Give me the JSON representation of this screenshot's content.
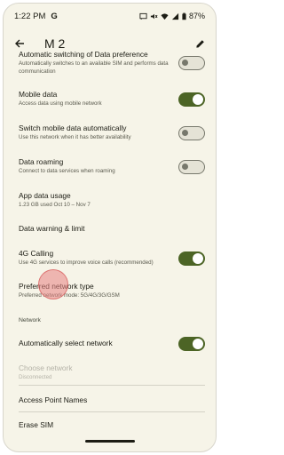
{
  "status_bar": {
    "time": "1:22 PM",
    "google_glyph": "G",
    "battery": "87%",
    "icons": [
      "message-icon",
      "mute-icon",
      "wifi-icon",
      "signal-icon",
      "battery-icon"
    ]
  },
  "header": {
    "title": "M 2",
    "back_icon": "back-arrow-icon",
    "edit_icon": "pencil-icon"
  },
  "rows": [
    {
      "title": "Automatic switching of Data preference",
      "subtitle": "Automatically switches to an available SIM and performs data communication",
      "toggle": "off"
    },
    {
      "title": "Mobile data",
      "subtitle": "Access data using mobile network",
      "toggle": "on"
    },
    {
      "title": "Switch mobile data automatically",
      "subtitle": "Use this network when it has better availability",
      "toggle": "off"
    },
    {
      "title": "Data roaming",
      "subtitle": "Connect to data services when roaming",
      "toggle": "off"
    },
    {
      "title": "App data usage",
      "subtitle": "1.23 GB used Oct 10 – Nov 7"
    },
    {
      "title": "Data warning & limit",
      "subtitle": ""
    },
    {
      "title": "4G Calling",
      "subtitle": "Use 4G services to improve voice calls (recommended)",
      "toggle": "on"
    },
    {
      "title": "Preferred network type",
      "subtitle": "Preferred network mode: 5G/4G/3G/GSM"
    }
  ],
  "network_section": {
    "header": "Network",
    "auto_select": {
      "title": "Automatically select network",
      "toggle": "on"
    },
    "choose_network": {
      "title": "Choose network",
      "subtitle": "Disconnected"
    }
  },
  "bottom_rows": [
    {
      "title": "Access Point Names"
    },
    {
      "title": "Erase SIM"
    }
  ],
  "colors": {
    "background": "#f6f4e8",
    "toggle_on": "#4c6425",
    "toggle_off": "#77786c",
    "text": "#1c1c14"
  }
}
